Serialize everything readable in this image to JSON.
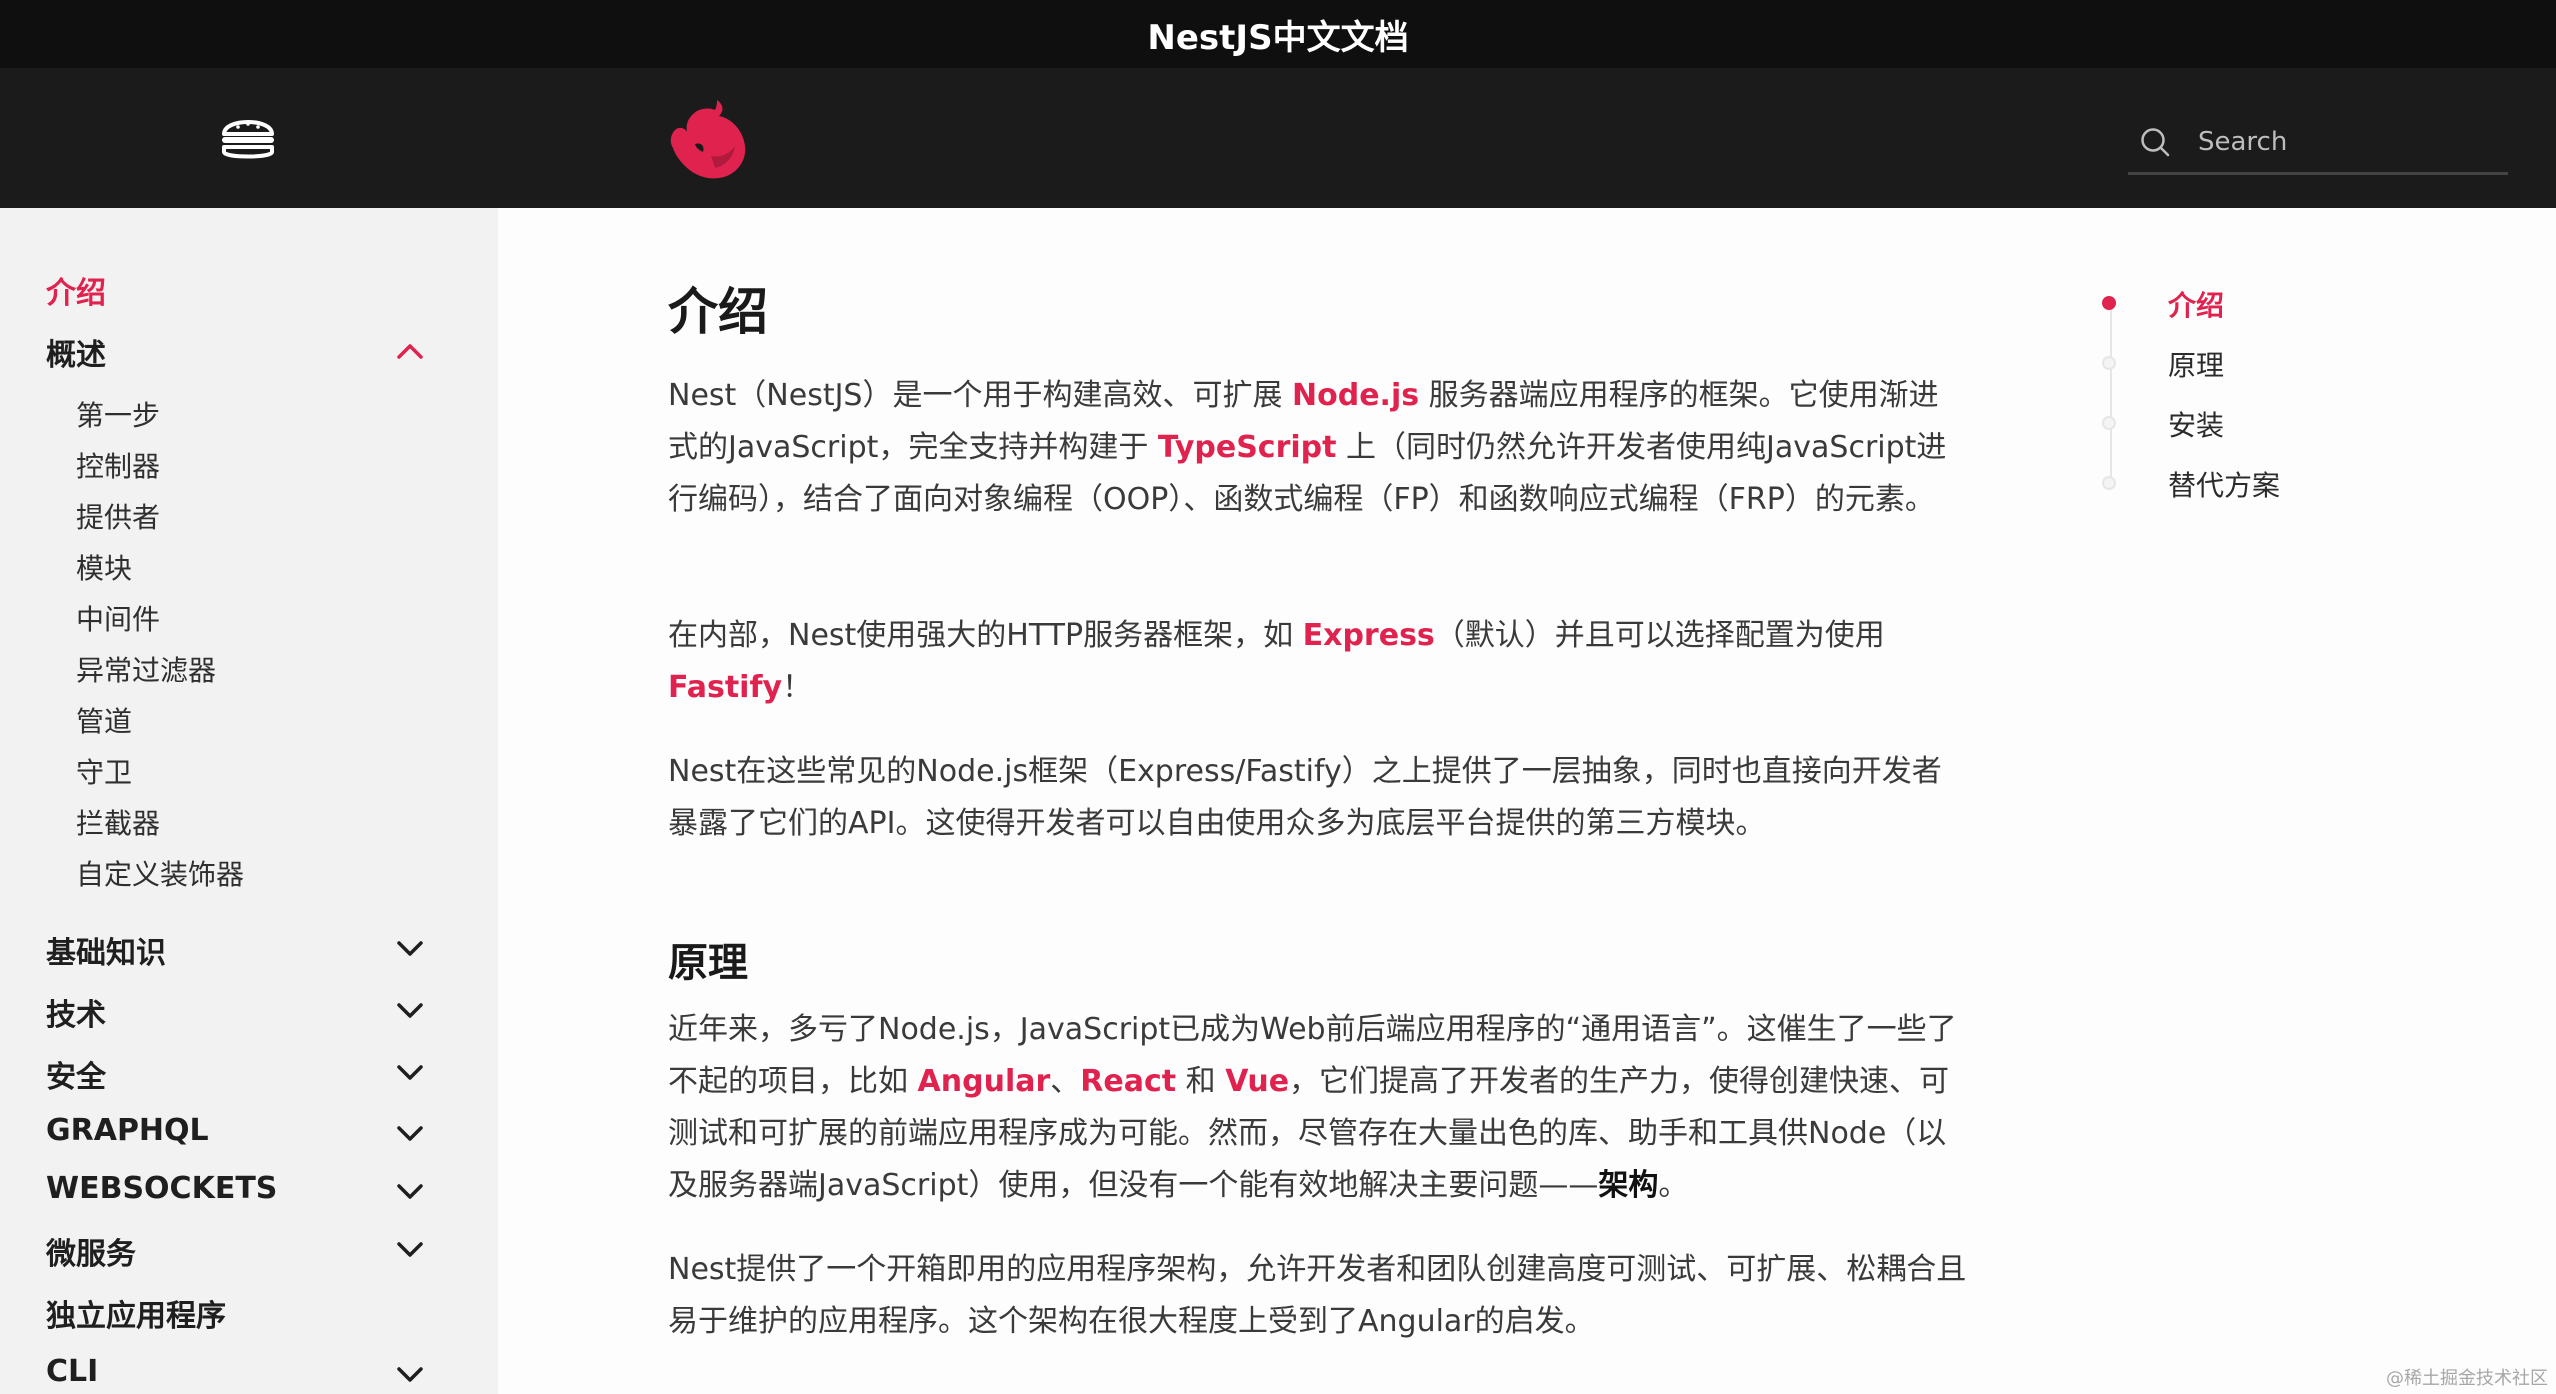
{
  "title_bar": {
    "title": "NestJS中文文档"
  },
  "header": {
    "menu_icon": "hamburger-menu-icon",
    "logo_icon": "nestjs-cat-logo",
    "search_icon": "search-icon",
    "search_placeholder": "Search",
    "search_value": ""
  },
  "sidebar": {
    "intro": "介绍",
    "overview": "概述",
    "overview_items": [
      "第一步",
      "控制器",
      "提供者",
      "模块",
      "中间件",
      "异常过滤器",
      "管道",
      "守卫",
      "拦截器",
      "自定义装饰器"
    ],
    "sections": [
      "基础知识",
      "技术",
      "安全",
      "GRAPHQL",
      "WEBSOCKETS",
      "微服务",
      "独立应用程序",
      "CLI"
    ]
  },
  "content": {
    "h1": "介绍",
    "p1": {
      "t1": "Nest（NestJS）是一个用于构建高效、可扩展 ",
      "link1": "Node.js",
      "t2": " 服务器端应用程序的框架。它使用渐进式的JavaScript，完全支持并构建于 ",
      "link2": "TypeScript",
      "t3": " 上（同时仍然允许开发者使用纯JavaScript进行编码），结合了面向对象编程（OOP）、函数式编程（FP）和函数响应式编程（FRP）的元素。"
    },
    "p2": {
      "t1": "在内部，Nest使用强大的HTTP服务器框架，如 ",
      "link1": "Express",
      "t2": "（默认）并且可以选择配置为使用 ",
      "link2": "Fastify",
      "t3": "！"
    },
    "p3": "Nest在这些常见的Node.js框架（Express/Fastify）之上提供了一层抽象，同时也直接向开发者暴露了它们的API。这使得开发者可以自由使用众多为底层平台提供的第三方模块。",
    "h2": "原理",
    "p4": {
      "t1": "近年来，多亏了Node.js，JavaScript已成为Web前后端应用程序的“通用语言”。这催生了一些了不起的项目，比如 ",
      "link1": "Angular",
      "sep1": "、",
      "link2": "React",
      "sep2": " 和 ",
      "link3": "Vue",
      "t2": "，它们提高了开发者的生产力，使得创建快速、可测试和可扩展的前端应用程序成为可能。然而，尽管存在大量出色的库、助手和工具供Node（以及服务器端JavaScript）使用，但没有一个能有效地解决主要问题——",
      "bold": "架构",
      "t3": "。"
    },
    "p5": "Nest提供了一个开箱即用的应用程序架构，允许开发者和团队创建高度可测试、可扩展、松耦合且易于维护的应用程序。这个架构在很大程度上受到了Angular的启发。"
  },
  "toc": {
    "items": [
      "介绍",
      "原理",
      "安装",
      "替代方案"
    ],
    "active": "介绍"
  },
  "watermark": "@稀土掘金技术社区",
  "colors": {
    "accent": "#e0234e",
    "topbar": "#1b1b1b",
    "sidebar_bg": "#f2f2f2"
  }
}
